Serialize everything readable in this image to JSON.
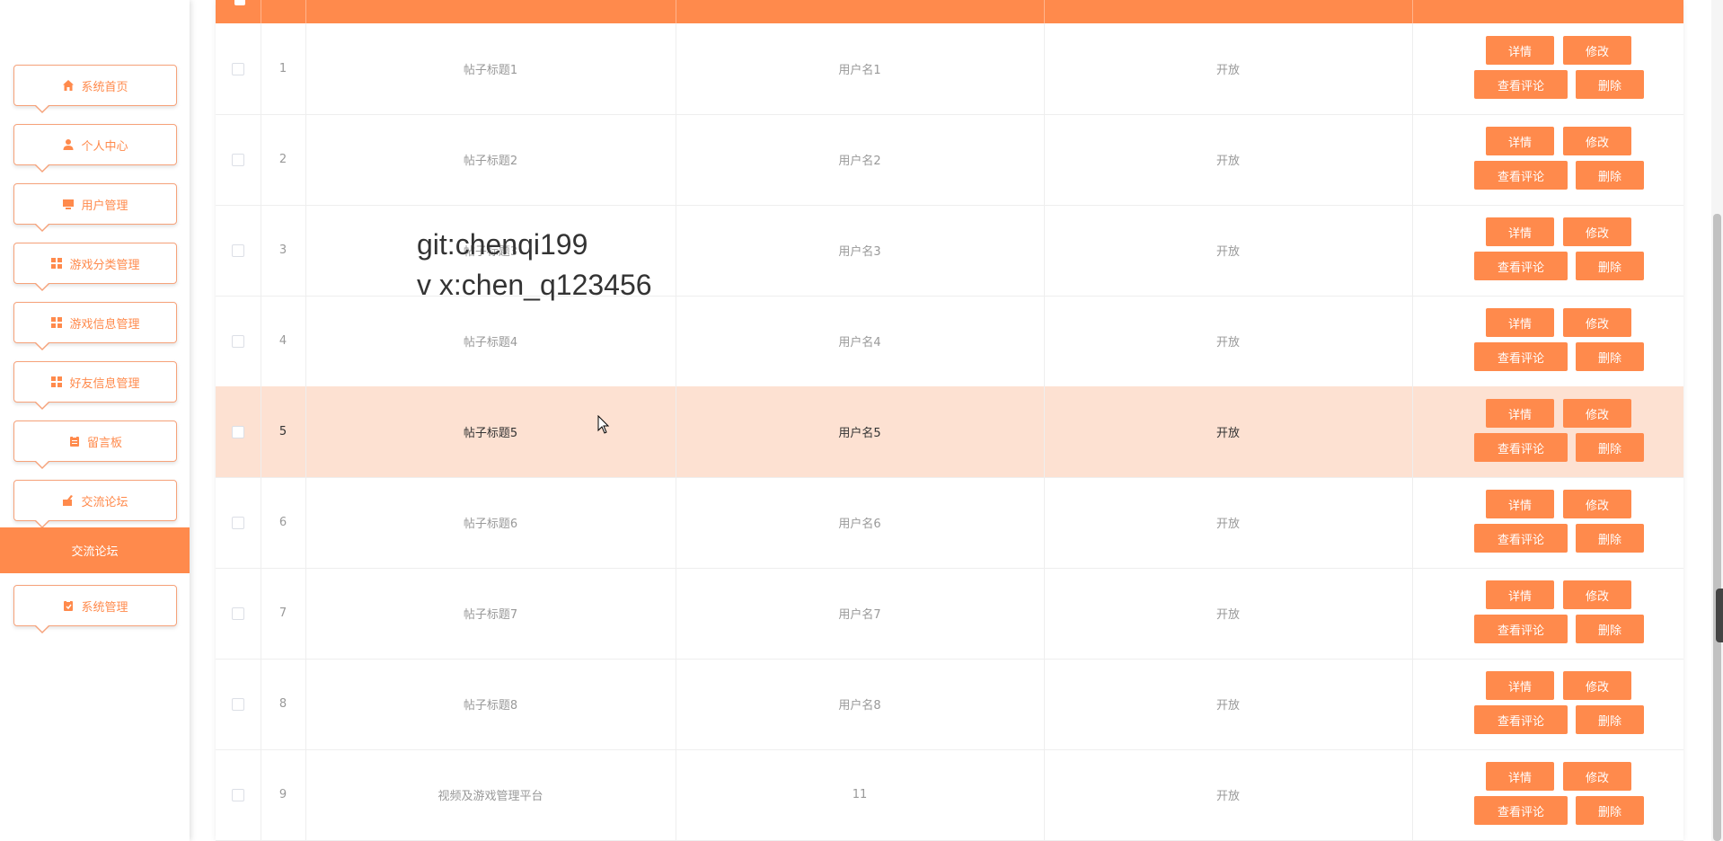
{
  "sidebar": {
    "items": [
      {
        "label": "系统首页",
        "icon": "home-icon"
      },
      {
        "label": "个人中心",
        "icon": "user-icon"
      },
      {
        "label": "用户管理",
        "icon": "monitor-icon"
      },
      {
        "label": "游戏分类管理",
        "icon": "grid-icon"
      },
      {
        "label": "游戏信息管理",
        "icon": "grid-icon"
      },
      {
        "label": "好友信息管理",
        "icon": "grid-icon"
      },
      {
        "label": "留言板",
        "icon": "clipboard-icon"
      },
      {
        "label": "交流论坛",
        "icon": "forum-icon"
      },
      {
        "label": "系统管理",
        "icon": "settings-clipboard-icon"
      }
    ],
    "active_label": "交流论坛"
  },
  "table": {
    "rows": [
      {
        "index": "1",
        "title": "帖子标题1",
        "user": "用户名1",
        "status": "开放"
      },
      {
        "index": "2",
        "title": "帖子标题2",
        "user": "用户名2",
        "status": "开放"
      },
      {
        "index": "3",
        "title": "帖子标题3",
        "user": "用户名3",
        "status": "开放"
      },
      {
        "index": "4",
        "title": "帖子标题4",
        "user": "用户名4",
        "status": "开放"
      },
      {
        "index": "5",
        "title": "帖子标题5",
        "user": "用户名5",
        "status": "开放"
      },
      {
        "index": "6",
        "title": "帖子标题6",
        "user": "用户名6",
        "status": "开放"
      },
      {
        "index": "7",
        "title": "帖子标题7",
        "user": "用户名7",
        "status": "开放"
      },
      {
        "index": "8",
        "title": "帖子标题8",
        "user": "用户名8",
        "status": "开放"
      },
      {
        "index": "9",
        "title": "视频及游戏管理平台",
        "user": "11",
        "status": "开放"
      }
    ],
    "highlighted_row": "5",
    "actions": {
      "detail": "详情",
      "edit": "修改",
      "comments": "查看评论",
      "delete": "删除"
    }
  },
  "watermark": {
    "line1": "git:chenqi199",
    "line2": "v x:chen_q123456"
  },
  "colors": {
    "accent": "#ff8a4c",
    "highlight_row": "#fde1d2"
  }
}
